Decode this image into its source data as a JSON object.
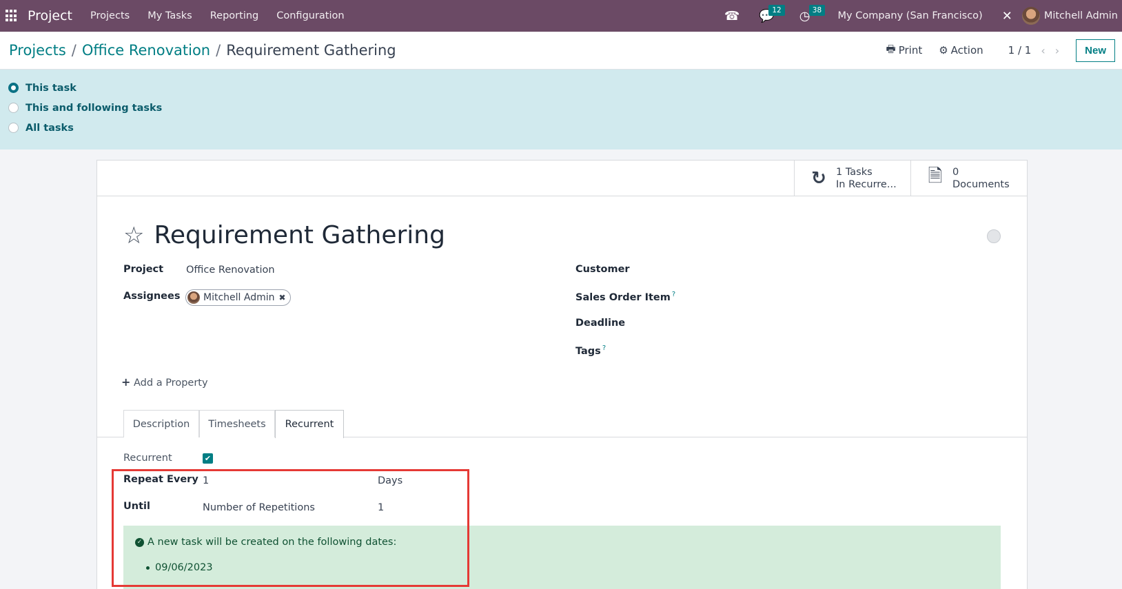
{
  "navbar": {
    "app_name": "Project",
    "menu": [
      "Projects",
      "My Tasks",
      "Reporting",
      "Configuration"
    ],
    "icons": {
      "apps": "apps-grid-icon",
      "phone": "phone-icon",
      "chat": "chat-icon",
      "activity": "clock-icon",
      "debug": "tools-icon"
    },
    "chat_count": "12",
    "activity_count": "38",
    "company": "My Company (San Francisco)",
    "user": "Mitchell Admin"
  },
  "control_panel": {
    "breadcrumb": [
      "Projects",
      "Office Renovation",
      "Requirement Gathering"
    ],
    "breadcrumb_sep": "/",
    "print_label": "Print",
    "action_label": "Action",
    "pager": "1 / 1",
    "new_label": "New"
  },
  "banner": {
    "options": [
      {
        "label": "This task",
        "checked": true
      },
      {
        "label": "This and following tasks",
        "checked": false
      },
      {
        "label": "All tasks",
        "checked": false
      }
    ]
  },
  "smart_buttons": [
    {
      "icon": "refresh-icon",
      "value": "1 Tasks",
      "label": "In Recurre..."
    },
    {
      "icon": "document-icon",
      "value": "0",
      "label": "Documents"
    }
  ],
  "task": {
    "title": "Requirement Gathering",
    "fields_left": {
      "project_label": "Project",
      "project_value": "Office Renovation",
      "assignees_label": "Assignees",
      "assignee": "Mitchell Admin"
    },
    "fields_right": {
      "customer_label": "Customer",
      "sales_order_label": "Sales Order Item",
      "deadline_label": "Deadline",
      "tags_label": "Tags",
      "help_mark": "?"
    },
    "add_property": "Add a Property"
  },
  "tabs": [
    {
      "label": "Description",
      "active": false
    },
    {
      "label": "Timesheets",
      "active": false
    },
    {
      "label": "Recurrent",
      "active": true
    }
  ],
  "recurrence": {
    "recurrent_label": "Recurrent",
    "recurrent_checked": true,
    "repeat_every_label": "Repeat Every",
    "repeat_every_value": "1",
    "repeat_unit": "Days",
    "until_label": "Until",
    "until_type": "Number of Repetitions",
    "repetitions": "1",
    "alert_text": "A new task will be created on the following dates:",
    "dates": [
      "09/06/2023"
    ]
  },
  "colors": {
    "navbar": "#6b4a65",
    "accent": "#017e84",
    "banner": "#d1eaee",
    "success_bg": "#d4ecdb",
    "highlight": "#e53935"
  }
}
